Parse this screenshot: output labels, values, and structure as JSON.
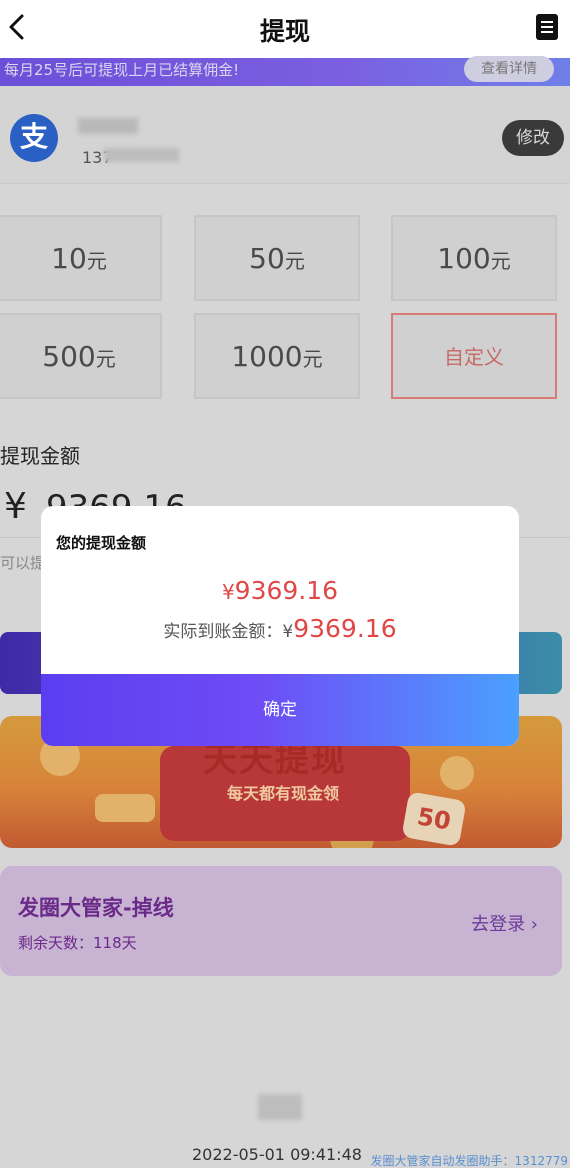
{
  "header": {
    "title": "提现",
    "back_icon": "chevron-left-icon",
    "menu_icon": "document-icon"
  },
  "notice": {
    "text": "每月25号后可提现上月已结算佣金!",
    "button": "查看详情"
  },
  "account": {
    "icon": "alipay-icon",
    "icon_glyph": "支",
    "number_visible": "137",
    "edit_button": "修改"
  },
  "amounts": [
    {
      "value": "10",
      "unit": "元"
    },
    {
      "value": "50",
      "unit": "元"
    },
    {
      "value": "100",
      "unit": "元"
    },
    {
      "value": "500",
      "unit": "元"
    },
    {
      "value": "1000",
      "unit": "元"
    },
    {
      "value": "自定义",
      "unit": ""
    }
  ],
  "withdraw": {
    "label": "提现金额",
    "currency": "¥",
    "amount_partial": "9369.16",
    "hint": "可以提"
  },
  "banner": {
    "title": "天天提现",
    "subtitle": "每天都有现金领",
    "tag": "50"
  },
  "promo": {
    "title": "发圈大管家-掉线",
    "days": "剩余天数：118天",
    "login": "去登录 ›"
  },
  "footer": {
    "timestamp": "2022-05-01 09:41:48",
    "watermark": "发圈大管家自动发圈助手：1312779"
  },
  "modal": {
    "title": "您的提现金额",
    "currency": "¥",
    "amount": "9369.16",
    "actual_label": "实际到账金额：",
    "actual_currency": "¥",
    "actual_amount": "9369.16",
    "confirm": "确定"
  },
  "colors": {
    "accent_red": "#e04848",
    "modal_button_start": "#5b3ef0",
    "modal_button_end": "#4aa0ff",
    "dim_background": "#d6d6d6"
  }
}
